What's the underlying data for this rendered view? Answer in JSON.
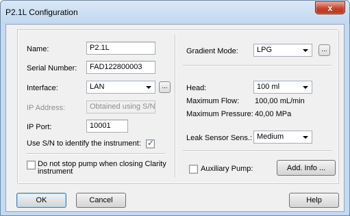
{
  "window": {
    "title": "P2.1L Configuration",
    "close_glyph": "x"
  },
  "left": {
    "name_label": "Name:",
    "name_value": "P2.1L",
    "serial_label": "Serial Number:",
    "serial_value": "FAD122800003",
    "interface_label": "Interface:",
    "interface_value": "LAN",
    "ip_address_label": "IP Address:",
    "ip_address_value": "Obtained using S/N",
    "ip_port_label": "IP Port:",
    "ip_port_value": "10001",
    "use_sn_label": "Use S/N to identify the instrument:",
    "use_sn_checked": true,
    "dont_stop_label_line1": "Do not stop pump when closing Clarity",
    "dont_stop_label_line2": "instrument",
    "dont_stop_checked": false
  },
  "right": {
    "gradient_label": "Gradient Mode:",
    "gradient_value": "LPG",
    "head_label": "Head:",
    "head_value": "100 ml",
    "max_flow_label": "Maximum Flow:",
    "max_flow_value": "100,00 mL/min",
    "max_pressure_label": "Maximum Pressure:",
    "max_pressure_value": "40,00 MPa",
    "leak_label": "Leak Sensor Sens.:",
    "leak_value": "Medium",
    "aux_label": "Auxiliary Pump:",
    "aux_checked": false,
    "add_info_label": "Add. Info ..."
  },
  "buttons": {
    "ok": "OK",
    "cancel": "Cancel",
    "help": "Help",
    "dots": "..."
  }
}
